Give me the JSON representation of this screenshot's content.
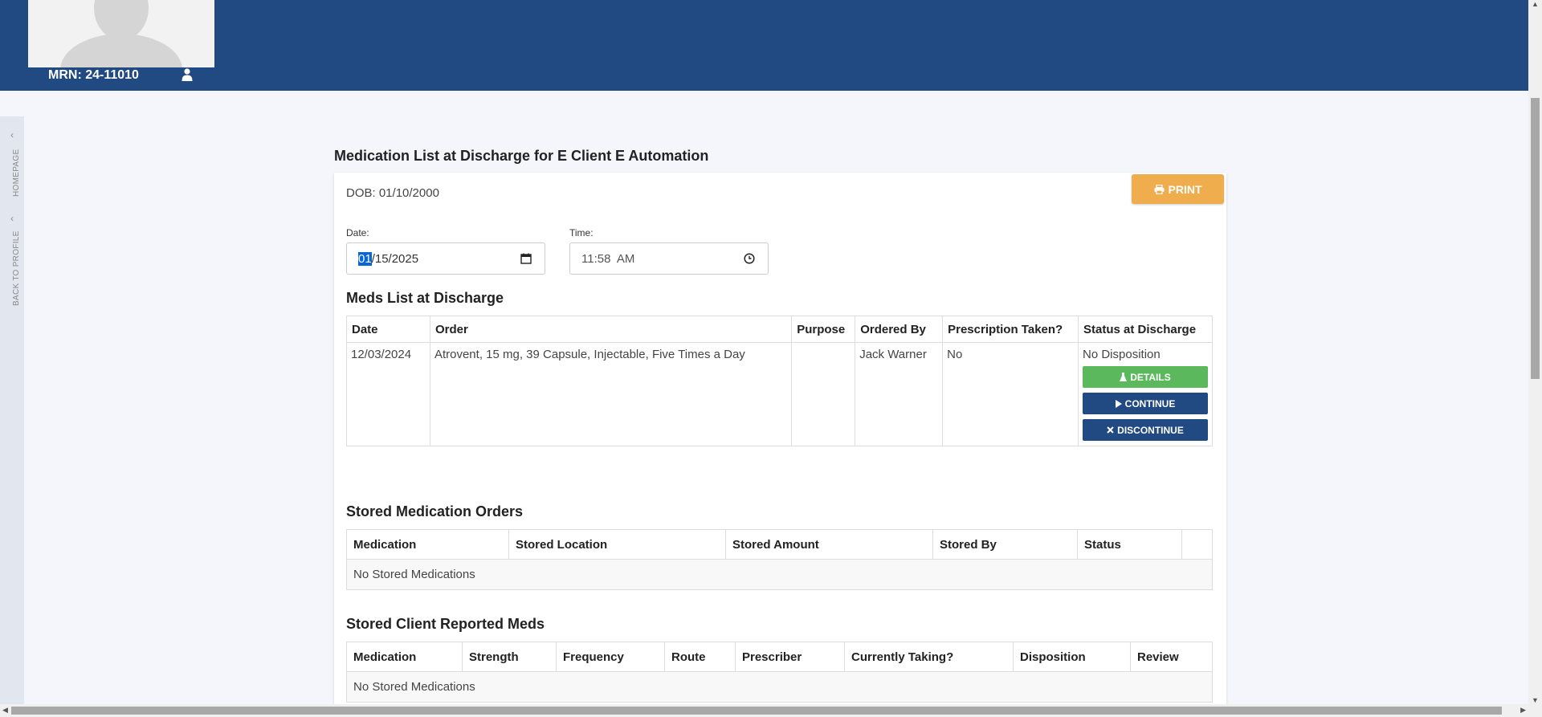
{
  "header": {
    "mrn": "MRN: 24-11010"
  },
  "sidebar": {
    "homepage_label": "HOMEPAGE",
    "back_label": "BACK TO PROFILE"
  },
  "page": {
    "title": "Medication List at Discharge for E Client E Automation",
    "print_label": "PRINT",
    "dob": "DOB: 01/10/2000",
    "date_label": "Date:",
    "date_month": "01",
    "date_rest": "/15/2025",
    "time_label": "Time:",
    "time_value": "11:58  AM"
  },
  "meds_discharge": {
    "title": "Meds List at Discharge",
    "headers": [
      "Date",
      "Order",
      "Purpose",
      "Ordered By",
      "Prescription Taken?",
      "Status at Discharge"
    ],
    "rows": [
      {
        "date": "12/03/2024",
        "order": "Atrovent, 15 mg, 39 Capsule, Injectable, Five Times a Day",
        "purpose": "",
        "ordered_by": "Jack Warner",
        "taken": "No",
        "status": "No Disposition",
        "details_label": "DETAILS",
        "continue_label": "CONTINUE",
        "discontinue_label": "DISCONTINUE"
      }
    ]
  },
  "stored_orders": {
    "title": "Stored Medication Orders",
    "headers": [
      "Medication",
      "Stored Location",
      "Stored Amount",
      "Stored By",
      "Status",
      ""
    ],
    "empty": "No Stored Medications"
  },
  "stored_reported": {
    "title": "Stored Client Reported Meds",
    "headers": [
      "Medication",
      "Strength",
      "Frequency",
      "Route",
      "Prescriber",
      "Currently Taking?",
      "Disposition",
      "Review"
    ],
    "empty": "No Stored Medications"
  }
}
